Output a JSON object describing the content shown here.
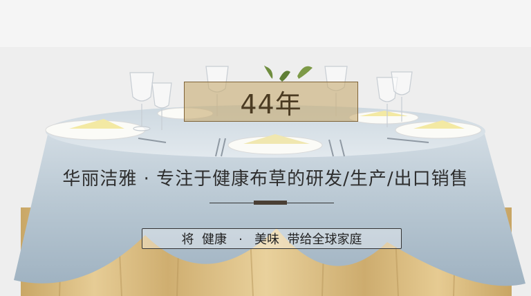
{
  "badge": {
    "text": "44年"
  },
  "headline": {
    "text": "华丽洁雅 · 专注于健康布草的研发/生产/出口销售"
  },
  "tagline": {
    "text": "将  健康   ·   美味  带给全球家庭"
  },
  "colors": {
    "tablecloth": "#b8c7d1",
    "skirt": "#d8b778",
    "badge_fill": "#c8ac74",
    "text_dark": "#2e2e2e"
  }
}
